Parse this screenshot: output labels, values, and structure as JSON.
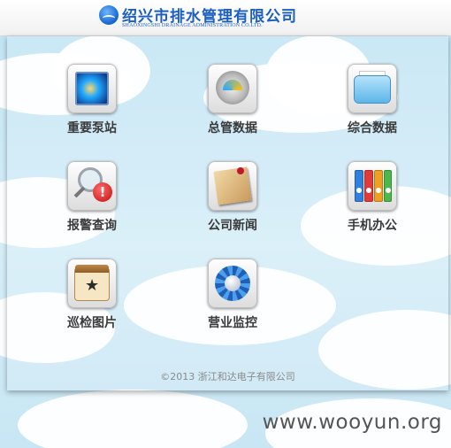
{
  "header": {
    "company_cn": "绍兴市排水管理有限公司",
    "company_en": "SHAOXINGSHI DRAINAGE ADMINISTRATION CO.LTD."
  },
  "tiles": [
    {
      "label": "重要泵站",
      "icon": "pump-station-icon"
    },
    {
      "label": "总管数据",
      "icon": "gauge-icon"
    },
    {
      "label": "综合数据",
      "icon": "folder-icon"
    },
    {
      "label": "报警查询",
      "icon": "alarm-search-icon"
    },
    {
      "label": "公司新闻",
      "icon": "notepad-icon"
    },
    {
      "label": "手机办公",
      "icon": "binders-icon"
    },
    {
      "label": "巡检图片",
      "icon": "calendar-icon"
    },
    {
      "label": "营业监控",
      "icon": "gear-icon"
    }
  ],
  "footer": {
    "copyright": "©2013 浙江和达电子有限公司"
  },
  "watermark": "www.wooyun.org",
  "colors": {
    "brand_blue": "#1b5fc0",
    "sky": "#cfe9f5",
    "label": "#3a3a3a"
  }
}
